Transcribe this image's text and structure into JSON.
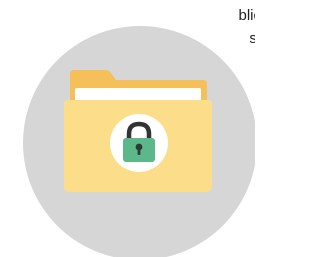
{
  "text_fragment": {
    "lines": [
      "blic",
      "s."
    ]
  },
  "illustration": {
    "icon": "locked-folder-icon",
    "colors": {
      "circle": "#d6d6d6",
      "folder_back": "#f5c05a",
      "folder_front": "#fcdd8a",
      "paper": "#ffffff",
      "badge": "#ffffff",
      "lock_body": "#5cb88a",
      "lock_shackle": "#333333",
      "keyhole": "#2f3a35"
    }
  }
}
